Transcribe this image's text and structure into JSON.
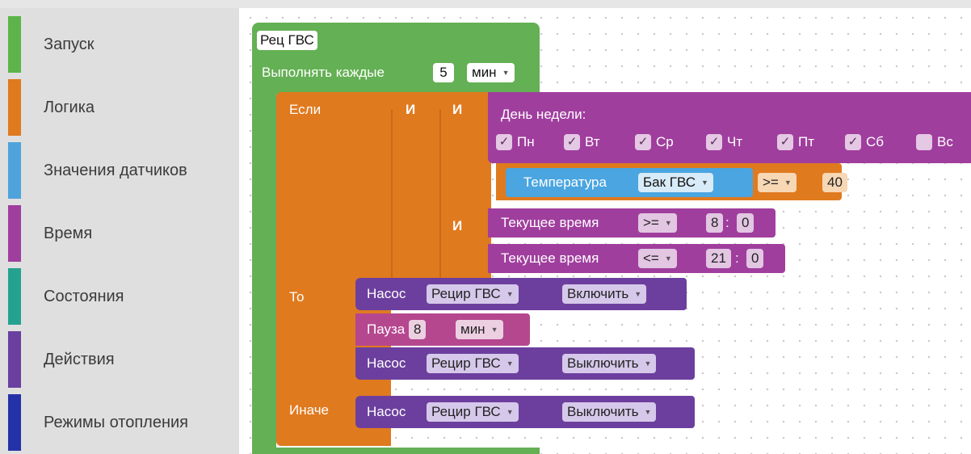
{
  "sidebar": {
    "categories": [
      {
        "label": "Запуск",
        "color": "#5cb44a"
      },
      {
        "label": "Логика",
        "color": "#e07a1f"
      },
      {
        "label": "Значения датчиков",
        "color": "#4fa3dc"
      },
      {
        "label": "Время",
        "color": "#a03e9e"
      },
      {
        "label": "Состояния",
        "color": "#24a28f"
      },
      {
        "label": "Действия",
        "color": "#6a3fa0"
      },
      {
        "label": "Режимы отопления",
        "color": "#2432a8"
      }
    ]
  },
  "program": {
    "name": "Рец ГВС",
    "schedule": {
      "prefix": "Выполнять каждые",
      "value": "5",
      "unit": "мин"
    },
    "if_label": "Если",
    "then_label": "То",
    "else_label": "Иначе",
    "and_label": "И",
    "weekday": {
      "label": "День недели:",
      "days": [
        {
          "label": "Пн",
          "checked": true
        },
        {
          "label": "Вт",
          "checked": true
        },
        {
          "label": "Ср",
          "checked": true
        },
        {
          "label": "Чт",
          "checked": true
        },
        {
          "label": "Пт",
          "checked": true
        },
        {
          "label": "Сб",
          "checked": true
        },
        {
          "label": "Вс",
          "checked": false
        }
      ]
    },
    "temperature": {
      "label": "Температура",
      "sensor": "Бак ГВС",
      "operator": ">=",
      "value": "40"
    },
    "time_from": {
      "label": "Текущее время",
      "operator": ">=",
      "hours": "8",
      "minutes": "0"
    },
    "time_to": {
      "label": "Текущее время",
      "operator": "<=",
      "hours": "21",
      "minutes": "0"
    },
    "time_separator": ":",
    "then_actions": [
      {
        "label": "Насос",
        "device": "Рецир ГВС",
        "action": "Включить"
      },
      {
        "label": "Пауза",
        "value": "8",
        "unit": "мин"
      },
      {
        "label": "Насос",
        "device": "Рецир ГВС",
        "action": "Выключить"
      }
    ],
    "else_action": {
      "label": "Насос",
      "device": "Рецир ГВС",
      "action": "Выключить"
    }
  }
}
